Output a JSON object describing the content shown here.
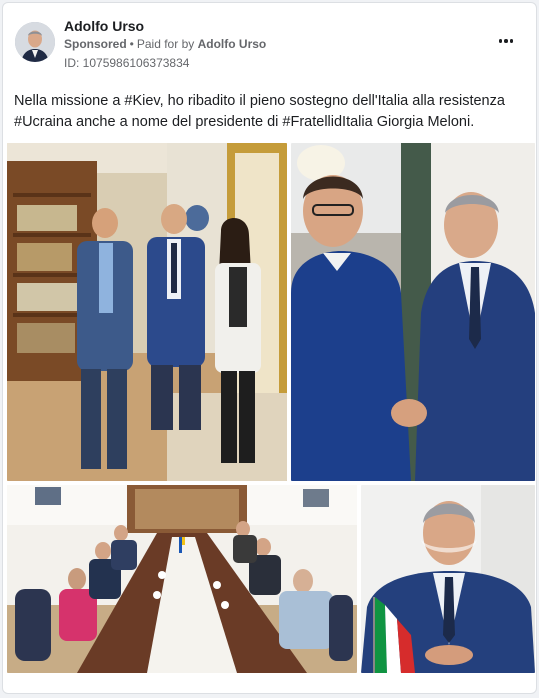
{
  "post": {
    "author": "Adolfo Urso",
    "sponsored_label": "Sponsored",
    "separator": "•",
    "paid_for_label": "Paid for by",
    "paid_for_name": "Adolfo Urso",
    "ad_id": "ID: 1075986106373834",
    "text_line1": "Nella missione a #Kiev, ho ribadito il pieno sostegno dell'Italia alla resistenza",
    "text_line2": "#Ucraina anche a nome del presidente di #FratellidItalia Giorgia Meloni."
  },
  "icons": {
    "avatar": "profile-photo",
    "menu": "more-options-icon"
  },
  "photos": [
    {
      "subject": "four people standing in an office with bookshelves"
    },
    {
      "subject": "two men shaking hands"
    },
    {
      "subject": "delegation meeting at a long table"
    },
    {
      "subject": "portrait of smiling man with Italian flag"
    }
  ],
  "colors": {
    "text": "#1c1e21",
    "secondary": "#65676b",
    "card_bg": "#ffffff"
  }
}
